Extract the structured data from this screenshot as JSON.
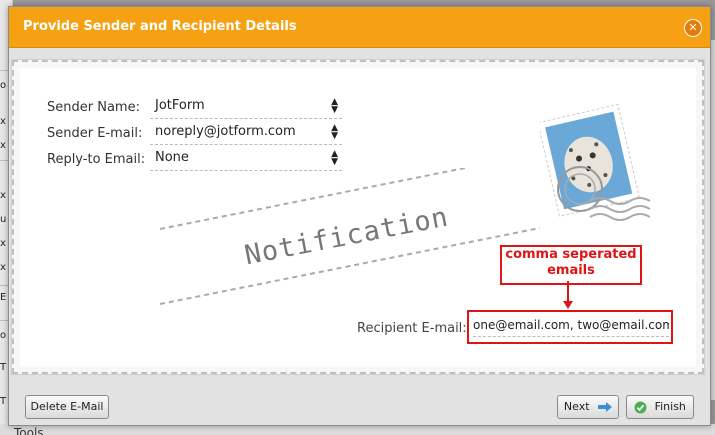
{
  "dialog": {
    "title": "Provide Sender and Recipient Details"
  },
  "sender": {
    "name_label": "Sender Name:",
    "name_value": "JotForm",
    "email_label": "Sender E-mail:",
    "email_value": "noreply@jotform.com",
    "reply_label": "Reply-to Email:",
    "reply_value": "None"
  },
  "envelope": {
    "notification_text": "Notification"
  },
  "callout": {
    "line1": "comma seperated",
    "line2": "emails"
  },
  "recipient": {
    "label": "Recipient E-mail:",
    "value": "one@email.com, two@email.com"
  },
  "footer": {
    "delete_label": "Delete E-Mail",
    "next_label": "Next",
    "finish_label": "Finish"
  },
  "background": {
    "bottom_text": "Tools"
  },
  "colors": {
    "titlebar": "#f5a113",
    "callout": "#e01414"
  }
}
